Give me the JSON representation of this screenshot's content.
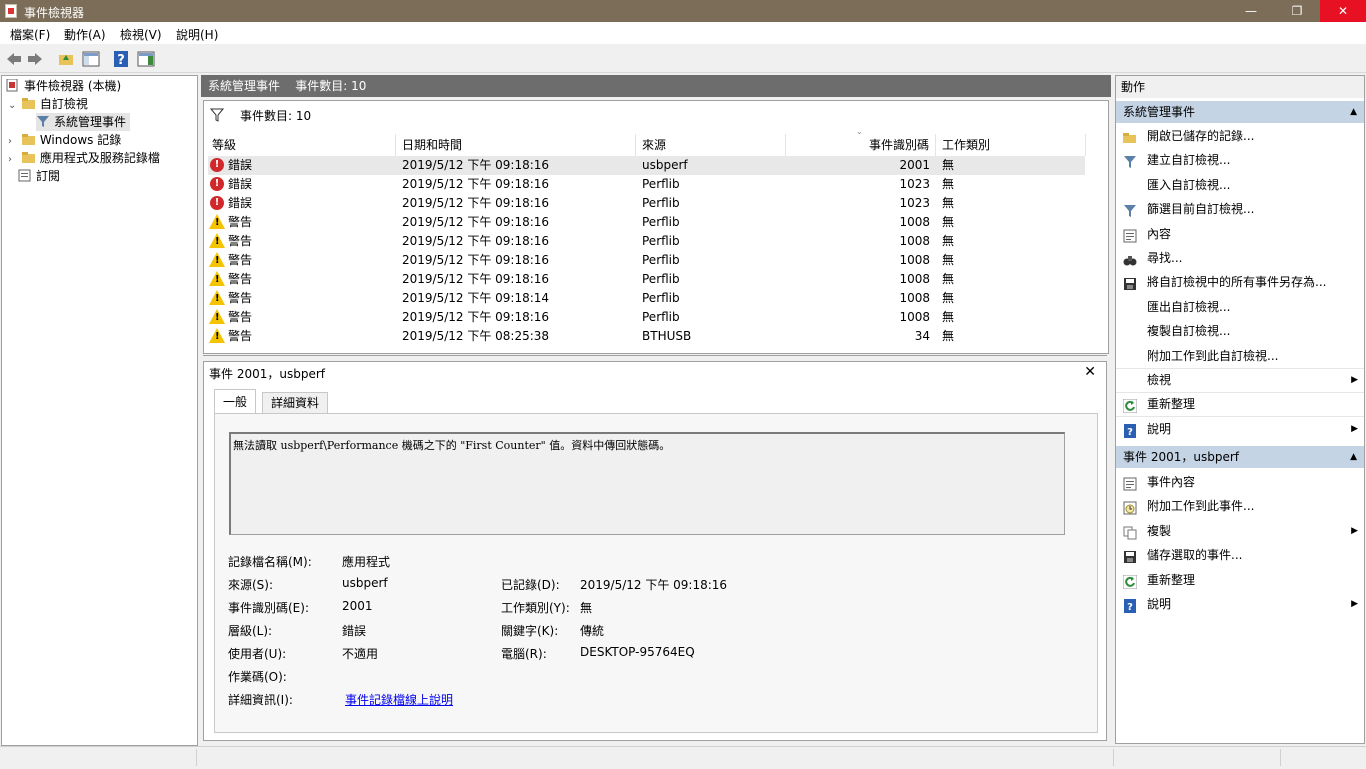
{
  "window": {
    "title": "事件檢視器",
    "minimize": "—",
    "maximize": "❐",
    "close": "✕"
  },
  "menu": [
    "檔案(F)",
    "動作(A)",
    "檢視(V)",
    "說明(H)"
  ],
  "tree": {
    "root": "事件檢視器 (本機)",
    "custom_views": "自訂檢視",
    "admin_events": "系統管理事件",
    "windows_logs": "Windows 記錄",
    "app_service_logs": "應用程式及服務記錄檔",
    "subscriptions": "訂閱"
  },
  "center": {
    "header": "系統管理事件    事件數目: 10",
    "filter_label": "事件數目: 10",
    "columns": [
      "等級",
      "日期和時間",
      "來源",
      "事件識別碼",
      "工作類別"
    ],
    "rows": [
      {
        "level_icon": "error-icon",
        "level": "錯誤",
        "datetime": "2019/5/12 下午 09:18:16",
        "source": "usbperf",
        "id": "2001",
        "category": "無"
      },
      {
        "level_icon": "error-icon",
        "level": "錯誤",
        "datetime": "2019/5/12 下午 09:18:16",
        "source": "Perflib",
        "id": "1023",
        "category": "無"
      },
      {
        "level_icon": "error-icon",
        "level": "錯誤",
        "datetime": "2019/5/12 下午 09:18:16",
        "source": "Perflib",
        "id": "1023",
        "category": "無"
      },
      {
        "level_icon": "warning-icon",
        "level": "警告",
        "datetime": "2019/5/12 下午 09:18:16",
        "source": "Perflib",
        "id": "1008",
        "category": "無"
      },
      {
        "level_icon": "warning-icon",
        "level": "警告",
        "datetime": "2019/5/12 下午 09:18:16",
        "source": "Perflib",
        "id": "1008",
        "category": "無"
      },
      {
        "level_icon": "warning-icon",
        "level": "警告",
        "datetime": "2019/5/12 下午 09:18:16",
        "source": "Perflib",
        "id": "1008",
        "category": "無"
      },
      {
        "level_icon": "warning-icon",
        "level": "警告",
        "datetime": "2019/5/12 下午 09:18:16",
        "source": "Perflib",
        "id": "1008",
        "category": "無"
      },
      {
        "level_icon": "warning-icon",
        "level": "警告",
        "datetime": "2019/5/12 下午 09:18:14",
        "source": "Perflib",
        "id": "1008",
        "category": "無"
      },
      {
        "level_icon": "warning-icon",
        "level": "警告",
        "datetime": "2019/5/12 下午 09:18:16",
        "source": "Perflib",
        "id": "1008",
        "category": "無"
      },
      {
        "level_icon": "warning-icon",
        "level": "警告",
        "datetime": "2019/5/12 下午 08:25:38",
        "source": "BTHUSB",
        "id": "34",
        "category": "無"
      }
    ]
  },
  "detail": {
    "title": "事件 2001，usbperf",
    "close": "✕",
    "tabs": [
      "一般",
      "詳細資料"
    ],
    "message": "無法讀取 usbperf\\Performance 機碼之下的 \"First Counter\" 值。資料中傳回狀態碼。",
    "fields": {
      "log_name_label": "記錄檔名稱(M):",
      "log_name": "應用程式",
      "source_label": "來源(S):",
      "source": "usbperf",
      "logged_label": "已記錄(D):",
      "logged": "2019/5/12 下午 09:18:16",
      "event_id_label": "事件識別碼(E):",
      "event_id": "2001",
      "task_label": "工作類別(Y):",
      "task": "無",
      "level_label": "層級(L):",
      "level": "錯誤",
      "keywords_label": "關鍵字(K):",
      "keywords": "傳統",
      "user_label": "使用者(U):",
      "user": "不適用",
      "computer_label": "電腦(R):",
      "computer": "DESKTOP-95764EQ",
      "opcode_label": "作業碼(O):",
      "more_info_label": "詳細資訊(I):",
      "more_info_link": "事件記錄檔線上說明"
    }
  },
  "actions": {
    "header": "動作",
    "section1": {
      "title": "系統管理事件",
      "items": [
        {
          "label": "開啟已儲存的記錄...",
          "icon": "folder-open-icon",
          "arrow": false
        },
        {
          "label": "建立自訂檢視...",
          "icon": "filter-icon",
          "arrow": false
        },
        {
          "label": "匯入自訂檢視...",
          "icon": "",
          "arrow": false
        },
        {
          "label": "篩選目前自訂檢視...",
          "icon": "filter-icon",
          "arrow": false
        },
        {
          "label": "內容",
          "icon": "properties-icon",
          "arrow": false
        },
        {
          "label": "尋找...",
          "icon": "binoculars-icon",
          "arrow": false
        },
        {
          "label": "將自訂檢視中的所有事件另存為...",
          "icon": "save-icon",
          "arrow": false
        },
        {
          "label": "匯出自訂檢視...",
          "icon": "",
          "arrow": false
        },
        {
          "label": "複製自訂檢視...",
          "icon": "",
          "arrow": false
        },
        {
          "label": "附加工作到此自訂檢視...",
          "icon": "",
          "arrow": false
        },
        {
          "label": "檢視",
          "icon": "",
          "arrow": true
        },
        {
          "label": "重新整理",
          "icon": "refresh-icon",
          "arrow": false
        },
        {
          "label": "說明",
          "icon": "help-icon",
          "arrow": true
        }
      ]
    },
    "section2": {
      "title": "事件 2001，usbperf",
      "items": [
        {
          "label": "事件內容",
          "icon": "properties-icon",
          "arrow": false
        },
        {
          "label": "附加工作到此事件...",
          "icon": "task-icon",
          "arrow": false
        },
        {
          "label": "複製",
          "icon": "copy-icon",
          "arrow": true
        },
        {
          "label": "儲存選取的事件...",
          "icon": "save-icon",
          "arrow": false
        },
        {
          "label": "重新整理",
          "icon": "refresh-icon",
          "arrow": false
        },
        {
          "label": "說明",
          "icon": "help-icon",
          "arrow": true
        }
      ]
    }
  },
  "colors": {
    "titlebar": "#7b6d57",
    "section_header": "#c5d4e4",
    "error": "#d0282b",
    "warning": "#f5c400",
    "link": "#0000ee"
  }
}
